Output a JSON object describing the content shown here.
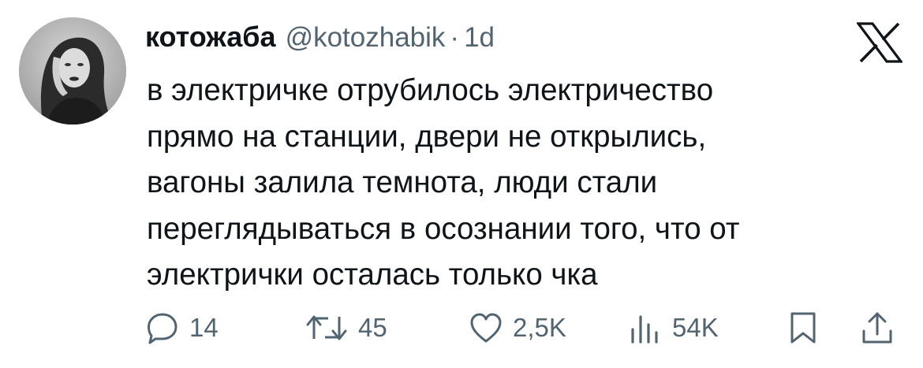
{
  "tweet": {
    "author": {
      "display_name": "котожаба",
      "handle": "@kotozhabik",
      "separator": "·",
      "time": "1d"
    },
    "text_lines": [
      "в электричке отрубилось электричество",
      "прямо на станции, двери не открылись,",
      "вагоны залила темнота, люди стали",
      "переглядываться в осознании того, что от",
      "электрички осталась только чка"
    ],
    "actions": {
      "replies": "14",
      "reposts": "45",
      "likes": "2,5K",
      "views": "54K"
    }
  },
  "icons": {
    "brand": "x-logo-icon",
    "reply": "reply-icon",
    "repost": "repost-icon",
    "like": "heart-icon",
    "views": "views-icon",
    "bookmark": "bookmark-icon",
    "share": "share-icon"
  },
  "colors": {
    "text_primary": "#0f1419",
    "text_secondary": "#536471",
    "background": "#ffffff"
  }
}
